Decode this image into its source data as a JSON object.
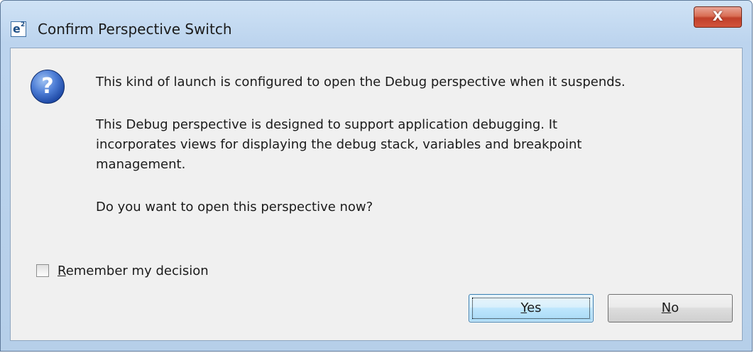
{
  "window": {
    "title": "Confirm Perspective Switch",
    "close_glyph": "X",
    "icon": "eclipse-e2-icon"
  },
  "dialog": {
    "icon": "question-icon",
    "icon_glyph": "?",
    "line1": "This kind of launch is configured to open the Debug perspective when it suspends.",
    "line2": "This Debug perspective is designed to support application debugging.  It",
    "line3": "incorporates views for displaying the debug stack, variables and breakpoint",
    "line4": "management.",
    "line5": "Do you want to open this perspective now?"
  },
  "remember": {
    "checked": false,
    "mnemonic": "R",
    "rest": "emember my decision"
  },
  "buttons": {
    "yes_mnemonic": "Y",
    "yes_rest": "es",
    "no_mnemonic": "N",
    "no_rest": "o"
  },
  "colors": {
    "frame": "#bcd4ee",
    "client": "#f0f0f0",
    "close_button": "#c0402a",
    "default_button": "#bee6fd"
  }
}
